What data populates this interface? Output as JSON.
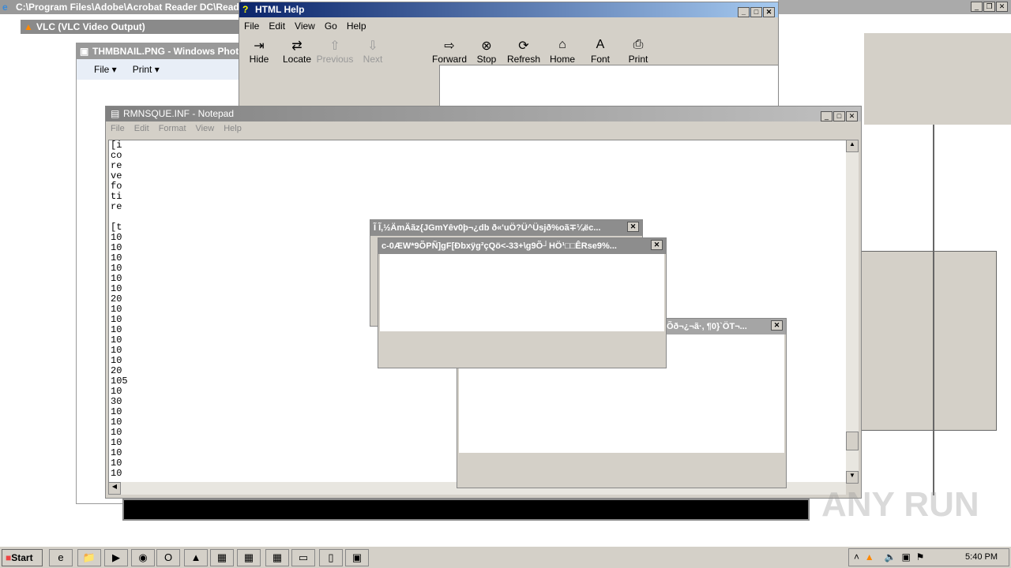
{
  "acrobat": {
    "title": "C:\\Program Files\\Adobe\\Acrobat Reader DC\\Read"
  },
  "vlc": {
    "title": "VLC (VLC Video Output)"
  },
  "photo": {
    "title": "THMBNAIL.PNG - Windows Photo",
    "menu": [
      "File",
      "Print"
    ]
  },
  "help": {
    "title": "HTML Help",
    "menu": [
      "File",
      "Edit",
      "View",
      "Go",
      "Help"
    ],
    "tools": [
      {
        "label": "Hide",
        "icon": "hide-icon",
        "g": "⇥"
      },
      {
        "label": "Locate",
        "icon": "locate-icon",
        "g": "⇄"
      },
      {
        "label": "Previous",
        "icon": "arrow-up-icon",
        "g": "⇧"
      },
      {
        "label": "Next",
        "icon": "arrow-down-icon",
        "g": "⇩"
      },
      {
        "label": "Forward",
        "icon": "arrow-right-icon",
        "g": "⇨"
      },
      {
        "label": "Stop",
        "icon": "stop-icon",
        "g": "⊗"
      },
      {
        "label": "Refresh",
        "icon": "refresh-icon",
        "g": "⟳"
      },
      {
        "label": "Home",
        "icon": "home-icon",
        "g": "⌂"
      },
      {
        "label": "Font",
        "icon": "font-icon",
        "g": "A"
      },
      {
        "label": "Print",
        "icon": "printer-icon",
        "g": "⎙"
      }
    ]
  },
  "notepad": {
    "title": "RMNSQUE.INF - Notepad",
    "menu": [
      "File",
      "Edit",
      "Format",
      "View",
      "Help"
    ],
    "lines": [
      "[i",
      "co",
      "re",
      "ve",
      "fo",
      "ti",
      "re",
      "",
      "[t",
      "10",
      "10",
      "10",
      "10",
      "10",
      "10",
      "20",
      "10",
      "10",
      "10",
      "10",
      "10",
      "10",
      "20",
      "105",
      "10",
      "30",
      "10",
      "10",
      "10",
      "10",
      "10",
      "10",
      "10"
    ]
  },
  "dialog1": {
    "title": "Ĩ Ĩ,½ÄmÄãz{JGmYêv0þ¬¿db ð«'uÖ?Ü^Üsjð%oã∓¼ëc..."
  },
  "dialog2": {
    "title": "c-0ÆW*9ÕPÑ]gF[Ðbxÿg²çQö<-33+\\g9Õ┘HÖ¹□□ÊRse9%..."
  },
  "dialog3": {
    "title": "Õð¬¿¬ã·, ¶0}`ÖT¬..."
  },
  "taskbar": {
    "start": "Start",
    "clock": "5:40 PM",
    "apps": [
      "ie-icon",
      "folder-icon",
      "media-player-icon",
      "chrome-icon",
      "opera-icon",
      "paint-icon",
      "app-icon",
      "winrar-icon",
      "calculator-icon",
      "window-icon",
      "notepad-icon",
      "photo-viewer-icon"
    ]
  },
  "watermark": "ANY RUN"
}
